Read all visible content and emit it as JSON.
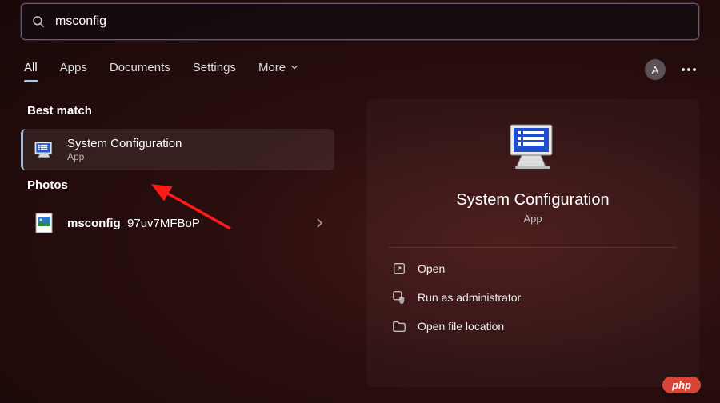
{
  "search": {
    "value": "msconfig"
  },
  "tabs": [
    {
      "label": "All",
      "active": true
    },
    {
      "label": "Apps"
    },
    {
      "label": "Documents"
    },
    {
      "label": "Settings"
    },
    {
      "label": "More"
    }
  ],
  "avatar_initial": "A",
  "sections": {
    "best_match": {
      "title": "Best match",
      "item": {
        "title": "System Configuration",
        "subtitle": "App"
      }
    },
    "photos": {
      "title": "Photos",
      "item_prefix": "msconfig",
      "item_suffix": "_97uv7MFBoP"
    }
  },
  "preview": {
    "title": "System Configuration",
    "subtitle": "App",
    "actions": [
      {
        "icon": "open",
        "label": "Open"
      },
      {
        "icon": "admin",
        "label": "Run as administrator"
      },
      {
        "icon": "folder",
        "label": "Open file location"
      }
    ]
  },
  "watermark": "php"
}
